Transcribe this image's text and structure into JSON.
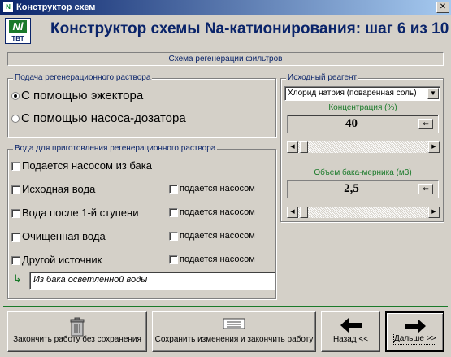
{
  "window": {
    "title": "Конструктор схем",
    "close_glyph": "✕",
    "icon": "app-logo-icon"
  },
  "logo": {
    "mark": "Ni",
    "text": "ТВТ"
  },
  "header": {
    "title": "Конструктор схемы Na-катионирования: шаг 6 из 10",
    "subtitle": "Схема регенерации фильтров"
  },
  "feed_group": {
    "label": "Подача регенерационного раствора",
    "options": [
      {
        "label": "С помощью эжектора",
        "selected": true
      },
      {
        "label": "С помощью насоса-дозатора",
        "selected": false
      }
    ]
  },
  "water_group": {
    "label": "Вода для приготовления регенерационного раствора",
    "items": [
      {
        "label": "Подается насосом из бака",
        "checked": false
      },
      {
        "label": "Исходная вода",
        "checked": false,
        "pump_label": "подается насосом"
      },
      {
        "label": "Вода после 1-й ступени",
        "checked": false,
        "pump_label": "подается насосом"
      },
      {
        "label": "Очищенная вода",
        "checked": false,
        "pump_label": "подается насосом"
      },
      {
        "label": "Другой источник",
        "checked": false,
        "pump_label": "подается насосом"
      }
    ],
    "source_value": "Из бака осветленной воды"
  },
  "reagent_group": {
    "label": "Исходный реагент",
    "reagent_value": "Хлорид натрия (поваренная соль)",
    "concentration_label": "Концентрация (%)",
    "concentration_value": "40",
    "tank_volume_label": "Объем бака-мерника (м3)",
    "tank_volume_value": "2,5"
  },
  "buttons": {
    "exit_no_save": "Закончить работу без сохранения",
    "save_exit": "Сохранить изменения и закончить работу",
    "back": "Назад <<",
    "next": "Дальше >>"
  },
  "colors": {
    "title_blue": "#0a246a",
    "accent_green": "#1a7a2a",
    "face": "#d4d0c8"
  }
}
